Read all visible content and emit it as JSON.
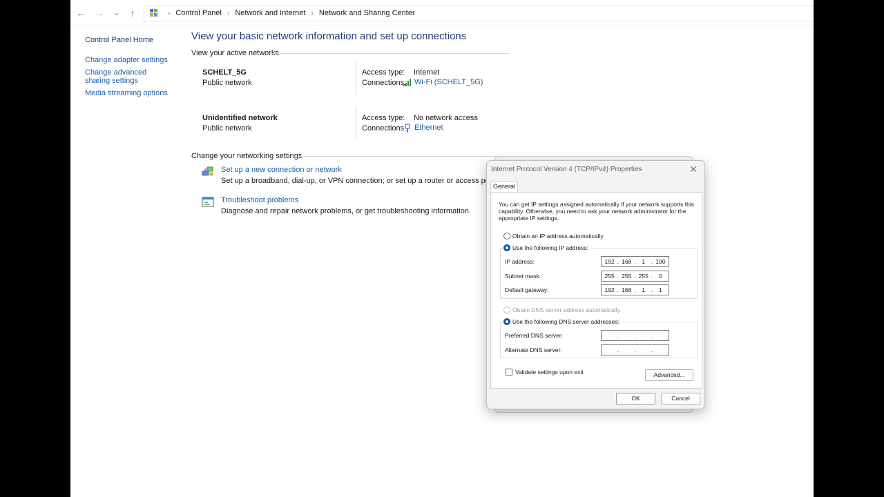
{
  "breadcrumb": [
    "Control Panel",
    "Network and Internet",
    "Network and Sharing Center"
  ],
  "nav": {
    "back_icon": "arrow-left-icon",
    "forward_icon": "arrow-right-icon",
    "recent_icon": "chevron-down-icon",
    "up_icon": "arrow-up-icon",
    "separator": "›"
  },
  "sidebar": {
    "home": "Control Panel Home",
    "items": [
      "Change adapter settings",
      "Change advanced sharing settings",
      "Media streaming options"
    ]
  },
  "main": {
    "title": "View your basic network information and set up connections",
    "active_networks_heading": "View your active networks",
    "networks": [
      {
        "name": "SCHELT_5G",
        "category": "Public network",
        "access_type_label": "Access type:",
        "access_type": "Internet",
        "connections_label": "Connections:",
        "connection": "Wi-Fi (SCHELT_5G)",
        "connection_icon": "wifi-signal-icon"
      },
      {
        "name": "Unidentified network",
        "category": "Public network",
        "access_type_label": "Access type:",
        "access_type": "No network access",
        "connections_label": "Connections:",
        "connection": "Ethernet",
        "connection_icon": "ethernet-icon"
      }
    ],
    "settings_heading": "Change your networking settings",
    "tasks": [
      {
        "link": "Set up a new connection or network",
        "desc": "Set up a broadband, dial-up, or VPN connection; or set up a router or access point.",
        "icon": "new-connection-icon"
      },
      {
        "link": "Troubleshoot problems",
        "desc": "Diagnose and repair network problems, or get troubleshooting information.",
        "icon": "troubleshoot-icon"
      }
    ]
  },
  "dialog": {
    "title": "Internet Protocol Version 4 (TCP/IPv4) Properties",
    "close": "✕",
    "tab": "General",
    "intro": "You can get IP settings assigned automatically if your network supports this capability. Otherwise, you need to ask your network administrator for the appropriate IP settings.",
    "ip_auto": "Obtain an IP address automatically",
    "ip_manual": "Use the following IP address:",
    "ip_address_label": "IP address:",
    "ip_address": [
      "192",
      "168",
      "1",
      "100"
    ],
    "subnet_label": "Subnet mask:",
    "subnet": [
      "255",
      "255",
      "255",
      "0"
    ],
    "gateway_label": "Default gateway:",
    "gateway": [
      "192",
      "168",
      "1",
      "1"
    ],
    "dns_auto": "Obtain DNS server address automatically",
    "dns_manual": "Use the following DNS server addresses:",
    "preferred_dns_label": "Preferred DNS server:",
    "preferred_dns": [
      "",
      "",
      "",
      ""
    ],
    "alternate_dns_label": "Alternate DNS server:",
    "alternate_dns": [
      "",
      "",
      "",
      ""
    ],
    "validate": "Validate settings upon exit",
    "advanced": "Advanced...",
    "ok": "OK",
    "cancel": "Cancel",
    "accent": "#0b5cad"
  }
}
